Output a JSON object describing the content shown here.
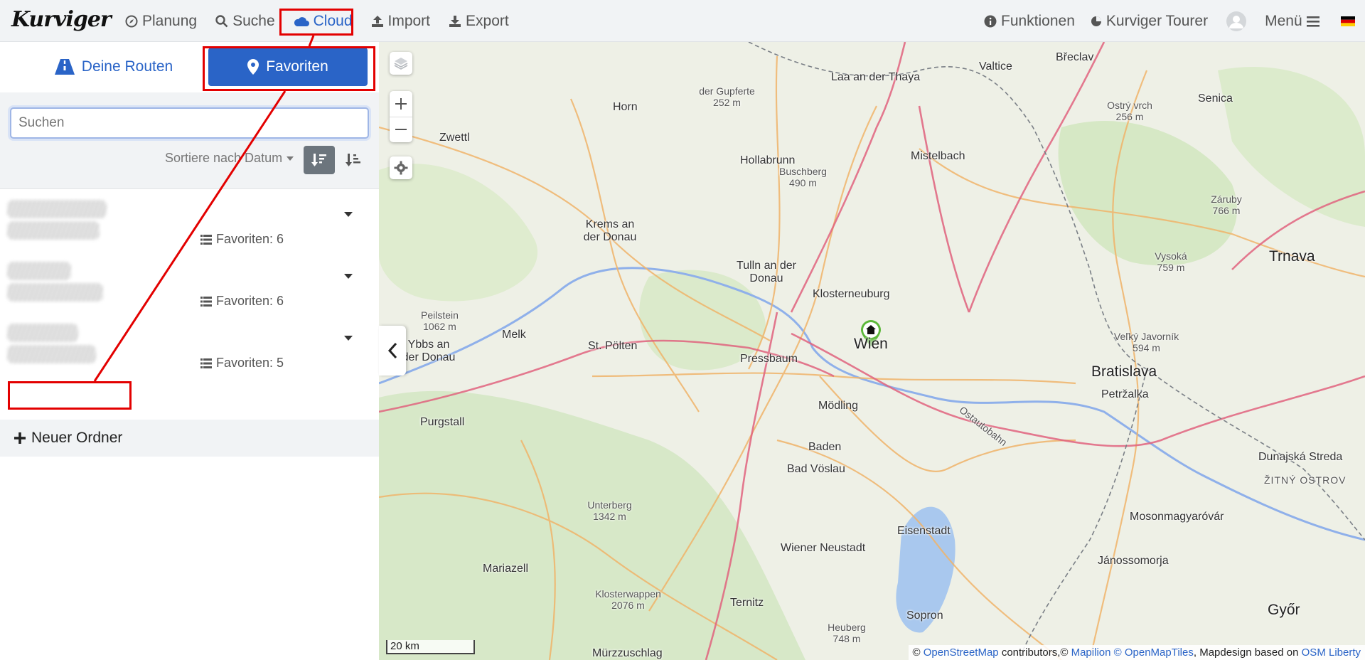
{
  "app": {
    "logo": "Kurviger"
  },
  "nav": {
    "planung": "Planung",
    "suche": "Suche",
    "cloud": "Cloud",
    "import": "Import",
    "export": "Export",
    "funktionen": "Funktionen",
    "tourer": "Kurviger Tourer",
    "menu": "Menü"
  },
  "sidebar": {
    "tab_routes": "Deine Routen",
    "tab_favorites": "Favoriten",
    "search_placeholder": "Suchen",
    "sort_label": "Sortiere nach Datum",
    "folders": [
      {
        "count_label": "Favoriten: 6"
      },
      {
        "count_label": "Favoriten: 6"
      },
      {
        "count_label": "Favoriten: 5"
      }
    ],
    "new_folder": "Neuer Ordner"
  },
  "map": {
    "scale": "20 km",
    "attribution": {
      "prefix": "©",
      "osm": "OpenStreetMap",
      "contrib": "contributors,©",
      "mapilion": "Mapilion",
      "omt": "© OpenMapTiles",
      "design": ", Mapdesign based on",
      "liberty": "OSM Liberty"
    },
    "places": [
      {
        "name": "Wien",
        "big": true
      },
      {
        "name": "Bratislava",
        "big": true
      },
      {
        "name": "Trnava",
        "big": true
      },
      {
        "name": "Győr",
        "big": true
      },
      {
        "name": "Krems an der Donau"
      },
      {
        "name": "Tulln an der Donau"
      },
      {
        "name": "Klosterneuburg"
      },
      {
        "name": "St. Pölten"
      },
      {
        "name": "Melk"
      },
      {
        "name": "Pressbaum"
      },
      {
        "name": "Mödling"
      },
      {
        "name": "Baden"
      },
      {
        "name": "Bad Vöslau"
      },
      {
        "name": "Wiener Neustadt"
      },
      {
        "name": "Eisenstadt"
      },
      {
        "name": "Sopron"
      },
      {
        "name": "Ternitz"
      },
      {
        "name": "Mariazell"
      },
      {
        "name": "Mürzzuschlag"
      },
      {
        "name": "Hollabrunn"
      },
      {
        "name": "Mistelbach"
      },
      {
        "name": "Horn"
      },
      {
        "name": "Zwettl"
      },
      {
        "name": "Laa an der Thaya"
      },
      {
        "name": "Valtice"
      },
      {
        "name": "Břeclav"
      },
      {
        "name": "Senica"
      },
      {
        "name": "Petržalka"
      },
      {
        "name": "Mosonmagyaróvár"
      },
      {
        "name": "Jánossomorja"
      },
      {
        "name": "Dunajská Streda"
      },
      {
        "name": "Purgstall"
      },
      {
        "name": "Ostautobahn"
      },
      {
        "name": "ŽITNÝ OSTROV"
      },
      {
        "name": "Unterberg 1342 m"
      },
      {
        "name": "Klosterwappen 2076 m"
      },
      {
        "name": "Heuberg 748 m"
      },
      {
        "name": "Buschberg 490 m"
      },
      {
        "name": "der Gupferte 252 m"
      },
      {
        "name": "Ostrý vrch 256 m"
      },
      {
        "name": "Záruby 766 m"
      },
      {
        "name": "Vysoká 759 m"
      },
      {
        "name": "Veľký Javorník 594 m"
      },
      {
        "name": "Peilstein 1062 m"
      },
      {
        "name": "Ybbs an der Donau"
      }
    ]
  }
}
